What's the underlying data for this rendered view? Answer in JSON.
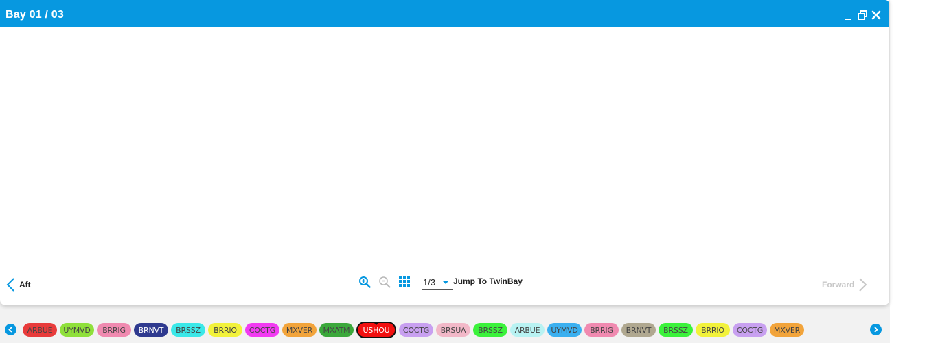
{
  "window": {
    "title": "Bay 01 / 03",
    "titlebar_color": "#0798e0",
    "controls": [
      "minimize-icon",
      "restore-icon",
      "close-icon"
    ]
  },
  "footer": {
    "aft_label": "Aft",
    "forward_label": "Forward",
    "page_value": "1/3",
    "jump_label": "Jump To TwinBay",
    "tools": [
      "zoom-in-icon",
      "zoom-out-icon",
      "grid-view-icon"
    ]
  },
  "chips": [
    {
      "label": "ARBUE",
      "color": "#e83b3b"
    },
    {
      "label": "UYMVD",
      "color": "#8fe03b"
    },
    {
      "label": "BRRIG",
      "color": "#f08ab0"
    },
    {
      "label": "BRNVT",
      "color": "#2f3a8f",
      "dark": true
    },
    {
      "label": "BRSSZ",
      "color": "#3be8e8"
    },
    {
      "label": "BRRIO",
      "color": "#f2f23b"
    },
    {
      "label": "COCTG",
      "color": "#f23bf2"
    },
    {
      "label": "MXVER",
      "color": "#f2a43b"
    },
    {
      "label": "MXATM",
      "color": "#3ba83b"
    },
    {
      "label": "USHOU",
      "color": "#f20f0f",
      "active": true
    },
    {
      "label": "COCTG",
      "color": "#c8a0f0"
    },
    {
      "label": "BRSUA",
      "color": "#f2b8c8"
    },
    {
      "label": "BRSSZ",
      "color": "#3bf23b"
    },
    {
      "label": "ARBUE",
      "color": "#b8f2f2"
    },
    {
      "label": "UYMVD",
      "color": "#3bb0f0"
    },
    {
      "label": "BRRIG",
      "color": "#f08ab0"
    },
    {
      "label": "BRNVT",
      "color": "#b0a890"
    },
    {
      "label": "BRSSZ",
      "color": "#3bf23b"
    },
    {
      "label": "BRRIO",
      "color": "#f2f23b"
    },
    {
      "label": "COCTG",
      "color": "#c8a0f0"
    },
    {
      "label": "MXVER",
      "color": "#f2a43b"
    }
  ]
}
